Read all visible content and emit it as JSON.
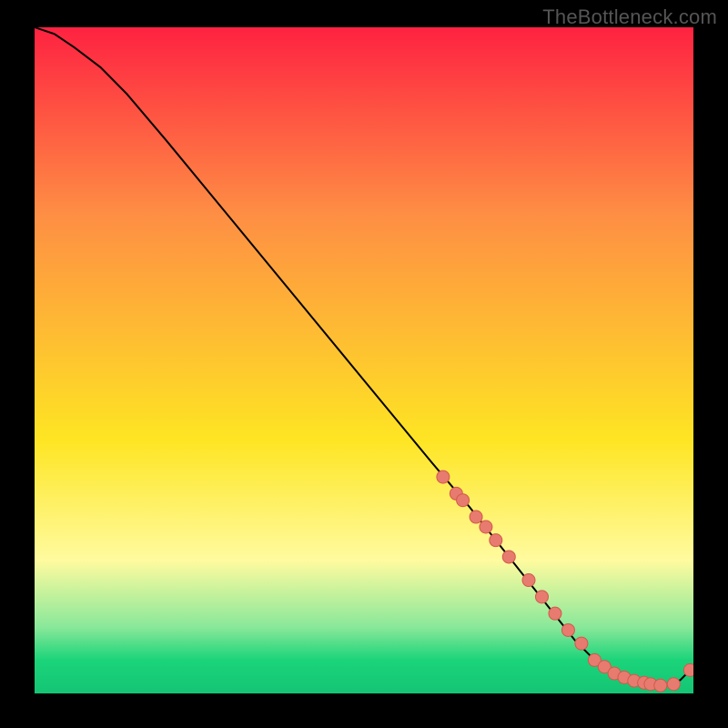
{
  "watermark": "TheBottleneck.com",
  "colors": {
    "gradient_top": "#fe2241",
    "gradient_mid1": "#fe8e44",
    "gradient_mid2": "#fee523",
    "gradient_band": "#fffb9f",
    "gradient_green1": "#8ae89a",
    "gradient_green2": "#1bd47a",
    "gradient_bottom": "#14c574",
    "curve": "#000000",
    "marker_fill": "#e77b6f",
    "marker_stroke": "#d3594c",
    "page_bg": "#000000"
  },
  "chart_data": {
    "type": "line",
    "title": "",
    "xlabel": "",
    "ylabel": "",
    "xlim": [
      0,
      100
    ],
    "ylim": [
      0,
      100
    ],
    "grid": false,
    "legend": false,
    "series": [
      {
        "name": "bottleneck-curve",
        "x": [
          0,
          3,
          6,
          10,
          14,
          20,
          30,
          40,
          50,
          60,
          66,
          70,
          74,
          78,
          82,
          85,
          88,
          90,
          92,
          94,
          96,
          98,
          100
        ],
        "y": [
          100,
          99,
          97,
          94,
          90,
          83,
          71,
          59,
          47,
          35,
          28,
          23,
          18,
          13,
          8,
          5,
          3,
          2,
          1.5,
          1.2,
          1.2,
          2,
          4
        ]
      }
    ],
    "markers": {
      "name": "highlighted-points",
      "x": [
        62,
        64,
        65,
        67,
        68.5,
        70,
        72,
        75,
        77,
        79,
        81,
        83,
        85,
        86.5,
        88,
        89.5,
        91,
        92.5,
        93.5,
        95,
        97,
        99.5
      ],
      "y": [
        32.5,
        30,
        29,
        26.5,
        25,
        23,
        20.5,
        17,
        14.5,
        12,
        9.5,
        7.5,
        5,
        4,
        3,
        2.4,
        1.9,
        1.6,
        1.4,
        1.2,
        1.4,
        3.5
      ]
    }
  }
}
